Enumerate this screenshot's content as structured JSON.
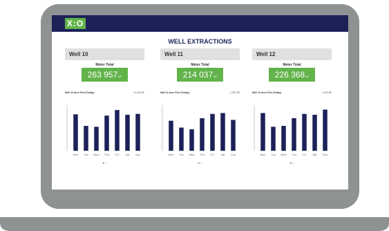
{
  "dashboard": {
    "logo": "X:O",
    "title": "WELL EXTRACTIONS",
    "panels": [
      {
        "name": "Well 10",
        "meter_label": "Meter Total",
        "meter_value": "263 957",
        "meter_unit": "AF",
        "row_label": "Well 10 Acre Feet (Today)",
        "row_value": "11 107 AF",
        "bars": [
          0.85,
          0.58,
          0.56,
          0.82,
          0.95,
          0.84,
          0.86
        ],
        "pager": "● ○"
      },
      {
        "name": "Well 11",
        "meter_label": "Meter Total",
        "meter_value": "214 037",
        "meter_unit": "AF",
        "row_label": "Well 11 Acre Feet (Today)",
        "row_value": "1 027 AF",
        "bars": [
          0.7,
          0.54,
          0.5,
          0.76,
          0.86,
          0.88,
          0.72
        ],
        "pager": "● ○"
      },
      {
        "name": "Well 12",
        "meter_label": "Meter Total",
        "meter_value": "226 368",
        "meter_unit": "AF",
        "row_label": "Well 12 Acre Feet (Today)",
        "row_value": "1 147 AF",
        "bars": [
          0.88,
          0.56,
          0.58,
          0.76,
          0.86,
          0.84,
          0.96
        ],
        "pager": "● ○"
      }
    ],
    "day_labels": [
      "Mon",
      "Tue",
      "Wed",
      "Thu",
      "Fri",
      "Sat",
      "Sun"
    ]
  },
  "colors": {
    "navy": "#1c2258",
    "green": "#62b34a",
    "panel_header": "#e0e0e0",
    "laptop": "#8e9292"
  }
}
